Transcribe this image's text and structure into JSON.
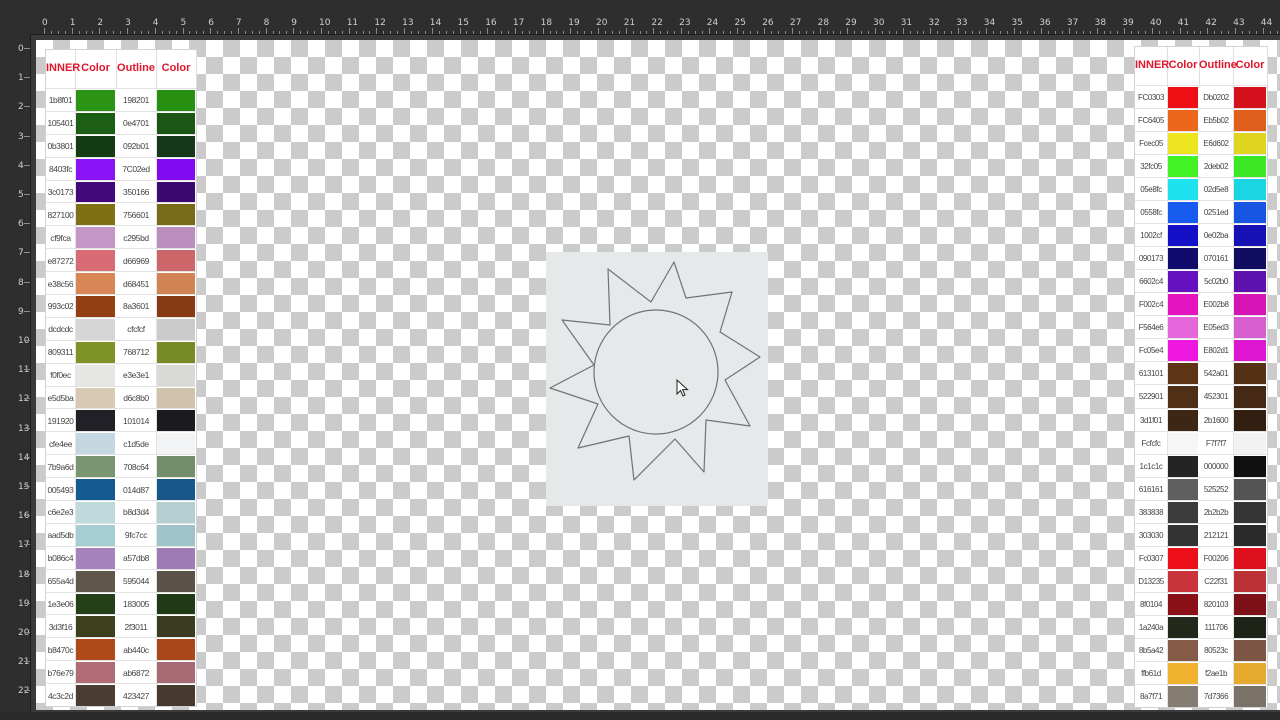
{
  "left_palette": {
    "headers": [
      "INNER",
      "Color",
      "Outline",
      "Color"
    ],
    "rows": [
      {
        "inner": "1b8f01",
        "inner_color": "#2c9415",
        "outline": "198201",
        "outline_color": "#289011"
      },
      {
        "inner": "105401",
        "inner_color": "#1d5e15",
        "outline": "0e4701",
        "outline_color": "#1c5614"
      },
      {
        "inner": "0b3801",
        "inner_color": "#153b13",
        "outline": "092b01",
        "outline_color": "#15381a"
      },
      {
        "inner": "8403fc",
        "inner_color": "#8a13f6",
        "outline": "7C02ed",
        "outline_color": "#830af0"
      },
      {
        "inner": "3c0173",
        "inner_color": "#41097a",
        "outline": "350166",
        "outline_color": "#3c0871"
      },
      {
        "inner": "827100",
        "inner_color": "#7f7016",
        "outline": "756601",
        "outline_color": "#786a18"
      },
      {
        "inner": "cf9fca",
        "inner_color": "#c597c6",
        "outline": "c295bd",
        "outline_color": "#bb8fbd"
      },
      {
        "inner": "e87272",
        "inner_color": "#d96b74",
        "outline": "d66969",
        "outline_color": "#cd6669"
      },
      {
        "inner": "e38c56",
        "inner_color": "#d98656",
        "outline": "d68451",
        "outline_color": "#d18353"
      },
      {
        "inner": "993c02",
        "inner_color": "#923f14",
        "outline": "8a3601",
        "outline_color": "#883a15"
      },
      {
        "inner": "dcdcdc",
        "inner_color": "#d6d6d6",
        "outline": "cfcfcf",
        "outline_color": "#cbcbcb"
      },
      {
        "inner": "809311",
        "inner_color": "#7e9228",
        "outline": "768712",
        "outline_color": "#768a25"
      },
      {
        "inner": "f0f0ec",
        "inner_color": "#e6e6e3",
        "outline": "e3e3e1",
        "outline_color": "#d9d9d7"
      },
      {
        "inner": "e5d5ba",
        "inner_color": "#d8c9b2",
        "outline": "d6c8b0",
        "outline_color": "#d0c2ab"
      },
      {
        "inner": "191920",
        "inner_color": "#202026",
        "outline": "101014",
        "outline_color": "#1a1a1f"
      },
      {
        "inner": "cfe4ee",
        "inner_color": "#c5d8e2",
        "outline": "c1d5de",
        "outline_color": "#f1f3f4"
      },
      {
        "inner": "7b9a6d",
        "inner_color": "#7a9670",
        "outline": "708c64",
        "outline_color": "#728e69"
      },
      {
        "inner": "005493",
        "inner_color": "#135a90",
        "outline": "014d87",
        "outline_color": "#175889"
      },
      {
        "inner": "c6e2e3",
        "inner_color": "#bedadb",
        "outline": "b8d3d4",
        "outline_color": "#b5cfd0"
      },
      {
        "inner": "aad5db",
        "inner_color": "#a5cdd2",
        "outline": "9fc7cc",
        "outline_color": "#9ec3c8"
      },
      {
        "inner": "b086c4",
        "inner_color": "#a782bb",
        "outline": "a57db8",
        "outline_color": "#a07bb3"
      },
      {
        "inner": "655a4d",
        "inner_color": "#5f564c",
        "outline": "595044",
        "outline_color": "#5a5248"
      },
      {
        "inner": "1e3e06",
        "inner_color": "#244018",
        "outline": "183005",
        "outline_color": "#213a16"
      },
      {
        "inner": "3d3f16",
        "inner_color": "#3d3f1d",
        "outline": "2f3011",
        "outline_color": "#3a3b1f"
      },
      {
        "inner": "b8470c",
        "inner_color": "#b14a19",
        "outline": "ab440c",
        "outline_color": "#a94719"
      },
      {
        "inner": "b76e79",
        "inner_color": "#b06d77",
        "outline": "ab6872",
        "outline_color": "#a86a74"
      },
      {
        "inner": "4c3c2d",
        "inner_color": "#4b3d31",
        "outline": "423427",
        "outline_color": "#46392e"
      }
    ]
  },
  "right_palette": {
    "headers": [
      "INNER",
      "Color",
      "Outline",
      "Color"
    ],
    "rows": [
      {
        "inner": "FC0303",
        "inner_color": "#ee0f14",
        "outline": "Db0202",
        "outline_color": "#d3101c"
      },
      {
        "inner": "FC6405",
        "inner_color": "#ec661b",
        "outline": "Eb5b02",
        "outline_color": "#e05f1c"
      },
      {
        "inner": "Fcec05",
        "inner_color": "#ece41e",
        "outline": "E6d602",
        "outline_color": "#dfd520"
      },
      {
        "inner": "32fc05",
        "inner_color": "#42f224",
        "outline": "2deb02",
        "outline_color": "#3ce724"
      },
      {
        "inner": "05e8fc",
        "inner_color": "#1ee2ef",
        "outline": "02d5e8",
        "outline_color": "#1bd6e2"
      },
      {
        "inner": "0558fc",
        "inner_color": "#185cef",
        "outline": "0251ed",
        "outline_color": "#1756e2"
      },
      {
        "inner": "1002cf",
        "inner_color": "#1410c8",
        "outline": "0e02ba",
        "outline_color": "#1511b5"
      },
      {
        "inner": "090173",
        "inner_color": "#100b6c",
        "outline": "070161",
        "outline_color": "#110d61"
      },
      {
        "inner": "6602c4",
        "inner_color": "#6511bf",
        "outline": "5c02b0",
        "outline_color": "#5d11ad"
      },
      {
        "inner": "F002c4",
        "inner_color": "#e414c0",
        "outline": "E002b8",
        "outline_color": "#d613b5"
      },
      {
        "inner": "F564e6",
        "inner_color": "#e667dc",
        "outline": "E05ed3",
        "outline_color": "#d75ecf"
      },
      {
        "inner": "Fc05e4",
        "inner_color": "#ee17e0",
        "outline": "E802d1",
        "outline_color": "#de16d2"
      },
      {
        "inner": "613101",
        "inner_color": "#5d3514",
        "outline": "542a01",
        "outline_color": "#543015"
      },
      {
        "inner": "522901",
        "inner_color": "#4f2f15",
        "outline": "452301",
        "outline_color": "#462914"
      },
      {
        "inner": "3d1f01",
        "inner_color": "#3d2613",
        "outline": "2b1600",
        "outline_color": "#321f12"
      },
      {
        "inner": "Fcfcfc",
        "inner_color": "#f6f6f6",
        "outline": "F7f7f7",
        "outline_color": "#f2f2f2"
      },
      {
        "inner": "1c1c1c",
        "inner_color": "#242424",
        "outline": "000000",
        "outline_color": "#101010"
      },
      {
        "inner": "616161",
        "inner_color": "#5e5e5e",
        "outline": "525252",
        "outline_color": "#545454"
      },
      {
        "inner": "383838",
        "inner_color": "#3b3b3b",
        "outline": "2b2b2b",
        "outline_color": "#343434"
      },
      {
        "inner": "303030",
        "inner_color": "#333333",
        "outline": "212121",
        "outline_color": "#2a2a2a"
      },
      {
        "inner": "Fc0307",
        "inner_color": "#ec0f1a",
        "outline": "F00206",
        "outline_color": "#df101d"
      },
      {
        "inner": "D13235",
        "inner_color": "#c8343a",
        "outline": "C22f31",
        "outline_color": "#bc3136"
      },
      {
        "inner": "8f0104",
        "inner_color": "#881016",
        "outline": "820103",
        "outline_color": "#7e1118"
      },
      {
        "inner": "1a240a",
        "inner_color": "#22291a",
        "outline": "111706",
        "outline_color": "#1d2317"
      },
      {
        "inner": "8b5a42",
        "inner_color": "#855b48",
        "outline": "80523c",
        "outline_color": "#7d5545"
      },
      {
        "inner": "ffb61d",
        "inner_color": "#f1b22f",
        "outline": "f2ae1b",
        "outline_color": "#e6aa2e"
      },
      {
        "inner": "8a7f71",
        "inner_color": "#867d72",
        "outline": "7d7366",
        "outline_color": "#7a7267"
      }
    ]
  },
  "ruler": {
    "top_labels": [
      "0",
      "1",
      "2",
      "3",
      "4",
      "5",
      "6",
      "7",
      "8",
      "9",
      "10",
      "11",
      "12",
      "13",
      "14",
      "15",
      "16",
      "17",
      "18",
      "19",
      "20",
      "21",
      "22",
      "23",
      "24",
      "25",
      "26",
      "27",
      "28",
      "29",
      "30",
      "31",
      "32",
      "33",
      "34",
      "35",
      "36",
      "37",
      "38",
      "39",
      "40",
      "41",
      "42",
      "43",
      "44"
    ],
    "left_labels": [
      "0",
      "1",
      "2",
      "3",
      "4",
      "5",
      "6",
      "7",
      "8",
      "9",
      "10",
      "11",
      "12",
      "13",
      "14",
      "15",
      "16",
      "17",
      "18",
      "19",
      "20",
      "21",
      "22"
    ]
  },
  "colors": {
    "header_text": "#e0162b",
    "artboard": "#e6e9e9",
    "stroke": "#6f7373"
  },
  "artwork": {
    "shape": "sun-outline"
  }
}
